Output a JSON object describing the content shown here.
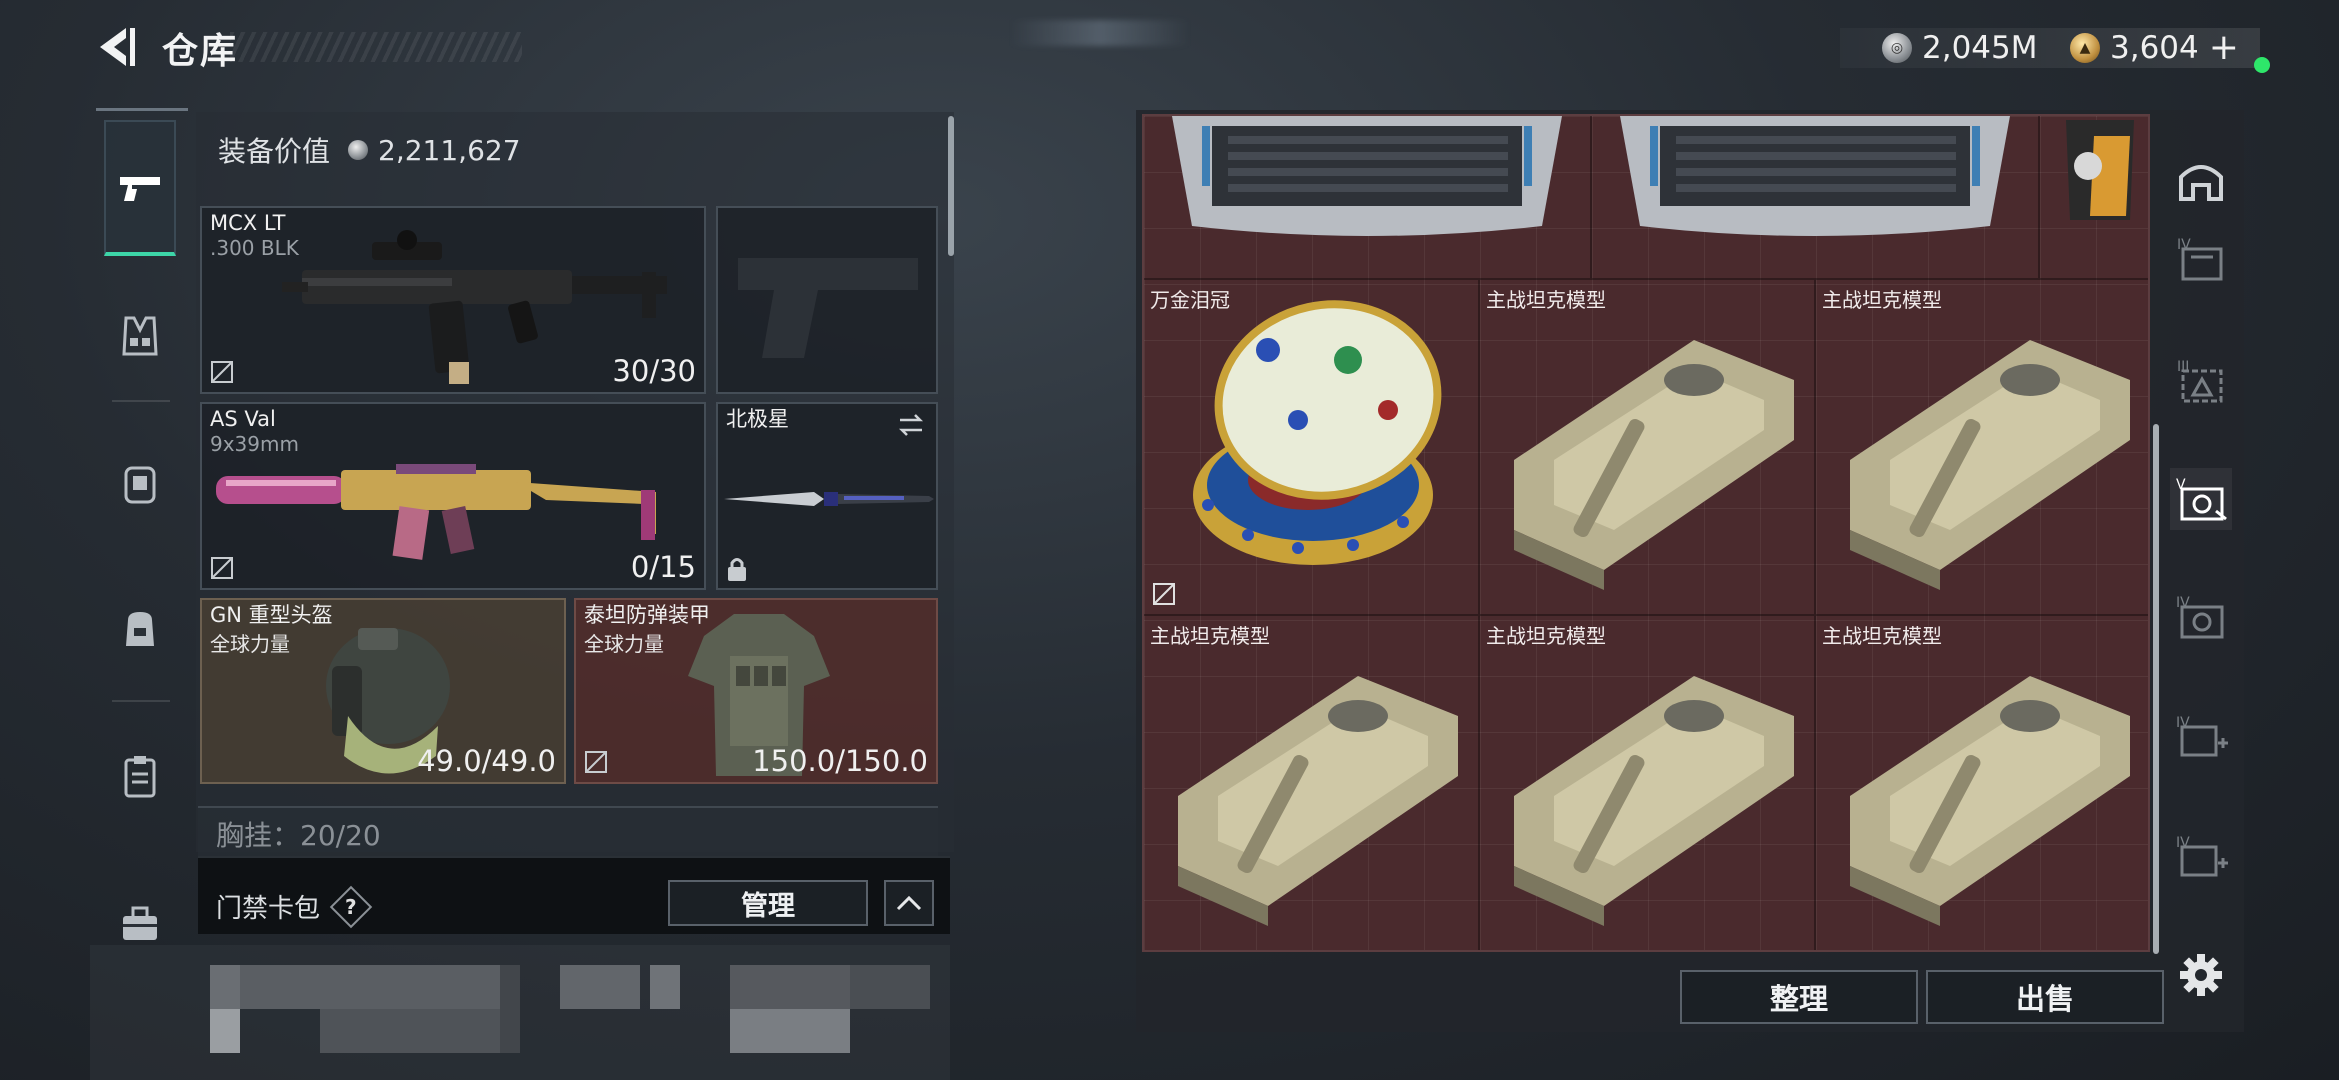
{
  "header": {
    "title": "仓库",
    "currency": [
      {
        "icon": "silver-coin-icon",
        "amount": "2,045M"
      },
      {
        "icon": "gold-coin-icon",
        "amount": "3,604",
        "plus": "+"
      }
    ],
    "status_color": "#2ee66a"
  },
  "left_rail": {
    "icons": [
      "pistol-icon",
      "vest-icon",
      "armor-icon",
      "backpack-icon",
      "clipboard-icon",
      "briefcase-icon"
    ],
    "active": "pistol-icon",
    "accent": "#3dd6a8"
  },
  "equipment": {
    "value_label": "装备价值",
    "value": "2,211,627",
    "primary": {
      "name": "MCX LT",
      "caliber": ".300 BLK",
      "ammo": "30/30"
    },
    "sidearm": {
      "name": ""
    },
    "secondary": {
      "name": "AS Val",
      "caliber": "9x39mm",
      "ammo": "0/15"
    },
    "melee": {
      "name": "北极星"
    },
    "helmet": {
      "name": "GN 重型头盔",
      "brand": "全球力量",
      "durability": "49.0/49.0"
    },
    "armor": {
      "name": "泰坦防弹装甲",
      "brand": "全球力量",
      "durability": "150.0/150.0"
    },
    "chest_rig": {
      "label": "胸挂：20/20"
    },
    "keycard": {
      "label": "门禁卡包",
      "help": "?",
      "manage": "管理"
    }
  },
  "stash": {
    "items": [
      {
        "label": ""
      },
      {
        "label": ""
      },
      {
        "label": ""
      },
      {
        "label": "万金泪冠"
      },
      {
        "label": "主战坦克模型"
      },
      {
        "label": "主战坦克模型"
      },
      {
        "label": "主战坦克模型"
      },
      {
        "label": "主战坦克模型"
      },
      {
        "label": "主战坦克模型"
      }
    ],
    "sort_label": "整理",
    "sell_label": "出售",
    "grid_color": "#4a2a2d"
  },
  "stash_tabs": {
    "icons": [
      "home-tab-icon",
      "stash-tab-iv-1-icon",
      "stash-tab-iii-icon",
      "stash-tab-v-icon",
      "stash-tab-iv-2-icon",
      "stash-tab-add-1-icon",
      "stash-tab-add-2-icon"
    ],
    "labels": [
      "",
      "IV",
      "III",
      "V",
      "IV",
      "IV",
      "IV"
    ]
  }
}
